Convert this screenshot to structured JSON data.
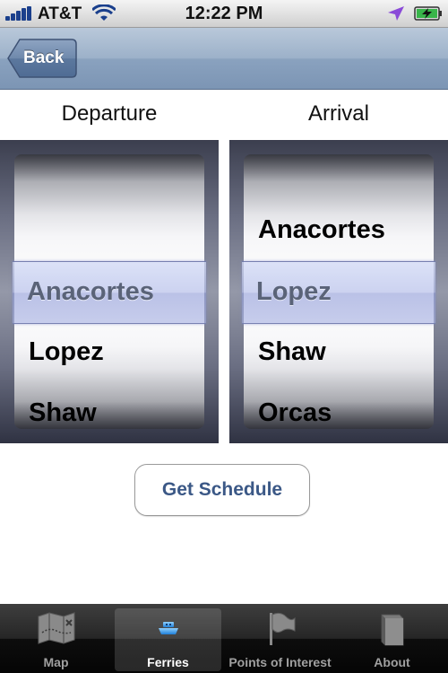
{
  "status_bar": {
    "carrier": "AT&T",
    "time": "12:22 PM",
    "signal_bars": 5,
    "battery": "charging"
  },
  "nav_bar": {
    "back_label": "Back"
  },
  "columns": {
    "departure_label": "Departure",
    "arrival_label": "Arrival"
  },
  "departure_picker": {
    "selected": "Anacortes",
    "items_below": [
      "Lopez",
      "Shaw"
    ]
  },
  "arrival_picker": {
    "item_above": "Anacortes",
    "selected": "Lopez",
    "items_below": [
      "Shaw",
      "Orcas"
    ]
  },
  "schedule_button_label": "Get Schedule",
  "tab_bar": {
    "tabs": [
      {
        "label": "Map",
        "icon": "map-icon",
        "selected": false
      },
      {
        "label": "Ferries",
        "icon": "ferry-icon",
        "selected": true
      },
      {
        "label": "Points of Interest",
        "icon": "flag-icon",
        "selected": false
      },
      {
        "label": "About",
        "icon": "book-icon",
        "selected": false
      }
    ]
  },
  "colors": {
    "nav_accent": "#7c95b4",
    "button_text": "#3b5886",
    "selection_band": "#b0bae8"
  }
}
